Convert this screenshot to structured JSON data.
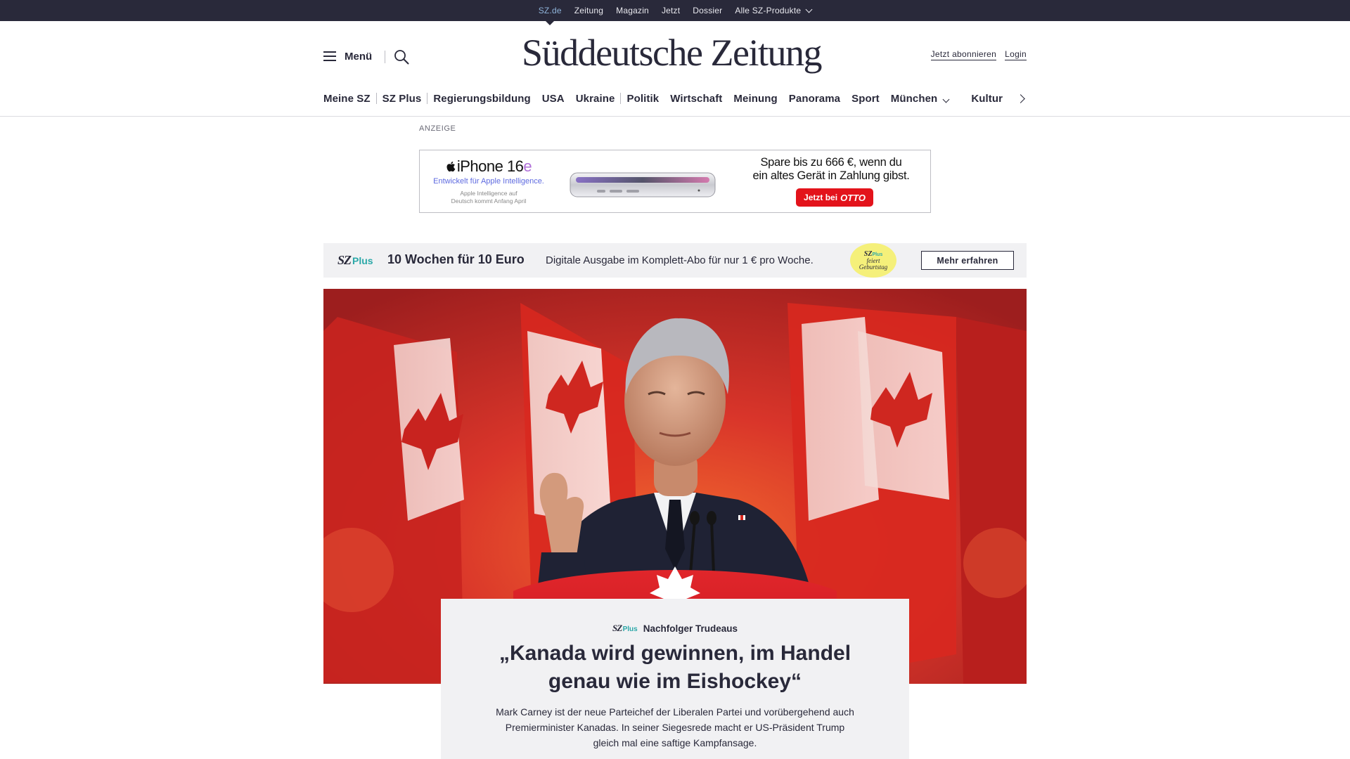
{
  "topbar": {
    "items": [
      {
        "label": "SZ.de",
        "active": true
      },
      {
        "label": "Zeitung"
      },
      {
        "label": "Magazin"
      },
      {
        "label": "Jetzt"
      },
      {
        "label": "Dossier"
      },
      {
        "label": "Alle SZ-Produkte",
        "has_dropdown": true
      }
    ]
  },
  "header": {
    "menu_label": "Menü",
    "logo": "Süddeutsche Zeitung",
    "subscribe": "Jetzt abonnieren",
    "login": "Login"
  },
  "nav": {
    "items": [
      "Meine SZ",
      "SZ Plus",
      "Regierungsbildung",
      "USA",
      "Ukraine",
      "Politik",
      "Wirtschaft",
      "Meinung",
      "Panorama",
      "Sport",
      "München",
      "Kultur"
    ]
  },
  "ad": {
    "label": "ANZEIGE",
    "product_name": "iPhone 16",
    "product_suffix": "e",
    "tagline": "Entwickelt für Apple Intelligence.",
    "fine_print_1": "Apple Intelligence auf",
    "fine_print_2": "Deutsch kommt Anfang April",
    "copy_line_1": "Spare bis zu 666 €, wenn du",
    "copy_line_2": "ein altes Gerät in Zahlung gibst.",
    "cta": "Jetzt bei",
    "cta_brand": "OTTO",
    "accent_color": "#e3131b"
  },
  "promo": {
    "logo_sz": "SZ",
    "logo_plus": "Plus",
    "title": "10 Wochen für 10 Euro",
    "text": "Digitale Ausgabe im Komplett-Abo für nur 1 € pro Woche.",
    "badge_sz": "SZ",
    "badge_plus": "Plus",
    "badge_line_1": "feiert",
    "badge_line_2": "Geburtstag",
    "button": "Mehr erfahren",
    "accent_color": "#2ba8a8"
  },
  "article": {
    "kicker_sz": "SZ",
    "kicker_plus": "Plus",
    "kicker": "Nachfolger Trudeaus",
    "headline": "„Kanada wird gewinnen, im Handel genau wie im Eishockey“",
    "teaser": "Mark Carney ist der neue Parteichef der Liberalen Partei und vorübergehend auch Premierminister Kanadas. In seiner Siegesrede macht er US-Präsident Trump gleich mal eine saftige Kampfansage."
  }
}
